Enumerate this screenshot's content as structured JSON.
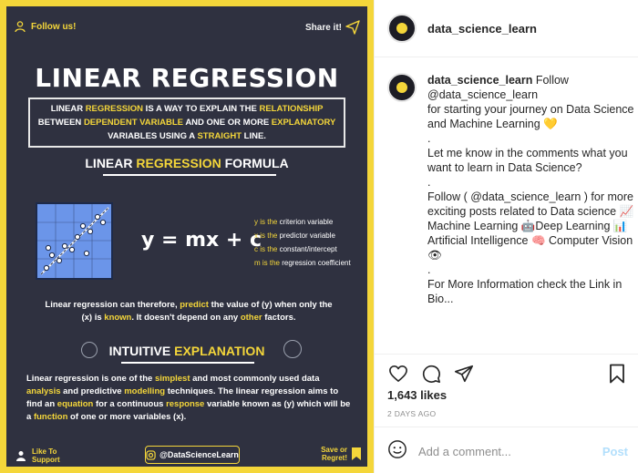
{
  "post": {
    "follow_us": "Follow us!",
    "share_it": "Share it!",
    "title": "LINEAR REGRESSION",
    "definition": [
      {
        "t": "LINEAR ",
        "h": false
      },
      {
        "t": "REGRESSION",
        "h": true
      },
      {
        "t": " IS A WAY TO EXPLAIN THE ",
        "h": false
      },
      {
        "t": "RELATIONSHIP",
        "h": true
      },
      {
        "t": " BETWEEN ",
        "h": false
      },
      {
        "t": "DEPENDENT VARIABLE",
        "h": true
      },
      {
        "t": " AND ONE OR MORE ",
        "h": false
      },
      {
        "t": "EXPLANATORY",
        "h": true
      },
      {
        "t": " VARIABLES USING A ",
        "h": false
      },
      {
        "t": "STRAIGHT",
        "h": true
      },
      {
        "t": " LINE.",
        "h": false
      }
    ],
    "formula_heading": [
      {
        "t": "LINEAR ",
        "h": false
      },
      {
        "t": "REGRESSION",
        "h": true
      },
      {
        "t": " FORMULA",
        "h": false
      }
    ],
    "equation": "y = mx + c",
    "legend": [
      [
        {
          "t": "y is the ",
          "h": true
        },
        {
          "t": "criterion variable",
          "h": false
        }
      ],
      [
        {
          "t": "x is the ",
          "h": true
        },
        {
          "t": "predictor variable",
          "h": false
        }
      ],
      [
        {
          "t": "c is the ",
          "h": true
        },
        {
          "t": "constant/intercept",
          "h": false
        }
      ],
      [
        {
          "t": "m is the ",
          "h": true
        },
        {
          "t": "regression coefficient",
          "h": false
        }
      ]
    ],
    "paragraph1": [
      {
        "t": "Linear regression can therefore, ",
        "h": false
      },
      {
        "t": "predict",
        "h": true
      },
      {
        "t": " the value of (y) when only the (x) is ",
        "h": false
      },
      {
        "t": "known",
        "h": true
      },
      {
        "t": ". It doesn't depend on any ",
        "h": false
      },
      {
        "t": "other",
        "h": true
      },
      {
        "t": " factors.",
        "h": false
      }
    ],
    "intuitive_heading": [
      {
        "t": "INTUITIVE ",
        "h": false
      },
      {
        "t": "EXPLANATION",
        "h": true
      }
    ],
    "paragraph2": [
      {
        "t": "Linear regression is one of the ",
        "h": false
      },
      {
        "t": "simplest",
        "h": true
      },
      {
        "t": " and most commonly used data ",
        "h": false
      },
      {
        "t": "analysis",
        "h": true
      },
      {
        "t": " and predictive ",
        "h": false
      },
      {
        "t": "modelling",
        "h": true
      },
      {
        "t": " techniques. The linear regression aims to find an ",
        "h": false
      },
      {
        "t": "equation",
        "h": true
      },
      {
        "t": " for a continuous ",
        "h": false
      },
      {
        "t": "response",
        "h": true
      },
      {
        "t": " variable known as (y) which will be a ",
        "h": false
      },
      {
        "t": "function",
        "h": true
      },
      {
        "t": " of one or more variables (x).",
        "h": false
      }
    ],
    "like_support": [
      "Like To",
      "Support"
    ],
    "handle": "@DataScienceLearn",
    "save_regret": [
      "Save or",
      "Regret!"
    ],
    "colors": {
      "accent": "#f4d63a",
      "background": "#2f3140",
      "plot": "#6b95e9"
    }
  },
  "sidebar": {
    "username": "data_science_learn",
    "follow_label": "Follow",
    "caption": "@data_science_learn\nfor starting your journey on Data Science and Machine Learning 💛\n.\nLet me know in the comments what you want to learn in Data Science?\n.\nFollow ( @data_science_learn ) for more exciting posts related to Data science 📈Machine Learning 🤖Deep Learning 📊Artificial Intelligence 🧠 Computer Vision 👁\n.\nFor More Information check the Link in Bio...",
    "likes": "1,643 likes",
    "posted": "2 DAYS AGO",
    "comment_placeholder": "Add a comment...",
    "post_button": "Post"
  }
}
